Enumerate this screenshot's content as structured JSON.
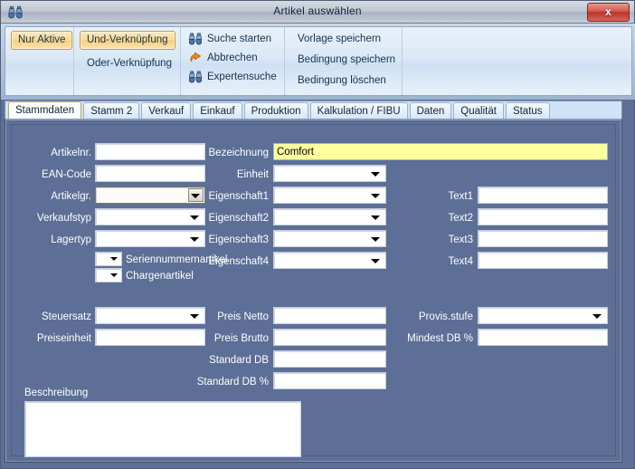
{
  "window": {
    "title": "Artikel auswählen",
    "icon": "binoculars-icon",
    "close_label": "x"
  },
  "ribbon": {
    "groups": [
      {
        "name": "filter-group",
        "items": [
          {
            "label": "Nur Aktive",
            "type": "toggle",
            "active": true
          }
        ]
      },
      {
        "name": "logic-group",
        "items": [
          {
            "label": "Und-Verknüpfung",
            "type": "toggle",
            "active": true
          },
          {
            "label": "Oder-Verknüpfung",
            "type": "toggle",
            "active": false
          }
        ]
      },
      {
        "name": "search-group",
        "items": [
          {
            "label": "Suche starten",
            "icon": "binoculars-icon"
          },
          {
            "label": "Abbrechen",
            "icon": "undo-arrow-icon"
          },
          {
            "label": "Expertensuche",
            "icon": "binoculars-icon"
          }
        ]
      },
      {
        "name": "template-group",
        "items": [
          {
            "label": "Vorlage speichern"
          },
          {
            "label": "Bedingung speichern"
          },
          {
            "label": "Bedingung löschen"
          }
        ]
      }
    ]
  },
  "tabs": {
    "selected_index": 0,
    "items": [
      {
        "label": "Stammdaten"
      },
      {
        "label": "Stamm 2"
      },
      {
        "label": "Verkauf"
      },
      {
        "label": "Einkauf"
      },
      {
        "label": "Produktion"
      },
      {
        "label": "Kalkulation / FIBU"
      },
      {
        "label": "Daten"
      },
      {
        "label": "Qualität"
      },
      {
        "label": "Status"
      }
    ]
  },
  "form": {
    "col1": [
      {
        "label": "Artikelnr.",
        "type": "text",
        "value": ""
      },
      {
        "label": "EAN-Code",
        "type": "text",
        "value": ""
      },
      {
        "label": "Artikelgr.",
        "type": "combo-raised",
        "value": ""
      },
      {
        "label": "Verkaufstyp",
        "type": "combo",
        "value": ""
      },
      {
        "label": "Lagertyp",
        "type": "combo",
        "value": ""
      }
    ],
    "flagrows": [
      {
        "label": "Seriennummernartikel",
        "type": "minicombo",
        "value": ""
      },
      {
        "label": "Chargenartikel",
        "type": "minicombo",
        "value": ""
      }
    ],
    "col2": [
      {
        "label": "Bezeichnung",
        "type": "text-highlight",
        "value": "Comfort"
      },
      {
        "label": "Einheit",
        "type": "combo",
        "value": ""
      },
      {
        "label": "Eigenschaft1",
        "type": "combo",
        "value": ""
      },
      {
        "label": "Eigenschaft2",
        "type": "combo",
        "value": ""
      },
      {
        "label": "Eigenschaft3",
        "type": "combo",
        "value": ""
      },
      {
        "label": "Eigenschaft4",
        "type": "combo",
        "value": ""
      }
    ],
    "col3": [
      {
        "label": "Text1",
        "type": "text",
        "value": ""
      },
      {
        "label": "Text2",
        "type": "text",
        "value": ""
      },
      {
        "label": "Text3",
        "type": "text",
        "value": ""
      },
      {
        "label": "Text4",
        "type": "text",
        "value": ""
      }
    ],
    "price_col1": [
      {
        "label": "Steuersatz",
        "type": "combo",
        "value": ""
      },
      {
        "label": "Preiseinheit",
        "type": "text",
        "value": ""
      }
    ],
    "price_col2": [
      {
        "label": "Preis Netto",
        "type": "text",
        "value": ""
      },
      {
        "label": "Preis Brutto",
        "type": "text",
        "value": ""
      },
      {
        "label": "Standard DB",
        "type": "text",
        "value": ""
      },
      {
        "label": "Standard DB %",
        "type": "text",
        "value": ""
      }
    ],
    "price_col3": [
      {
        "label": "Provis.stufe",
        "type": "combo",
        "value": ""
      },
      {
        "label": "Mindest DB %",
        "type": "text",
        "value": ""
      }
    ],
    "description": {
      "label": "Beschreibung",
      "value": ""
    }
  },
  "colors": {
    "panel_bg": "#5d6f96",
    "highlight_field": "#ffff9e",
    "active_chip": "#f8cf7f",
    "close_button": "#bb3327"
  }
}
